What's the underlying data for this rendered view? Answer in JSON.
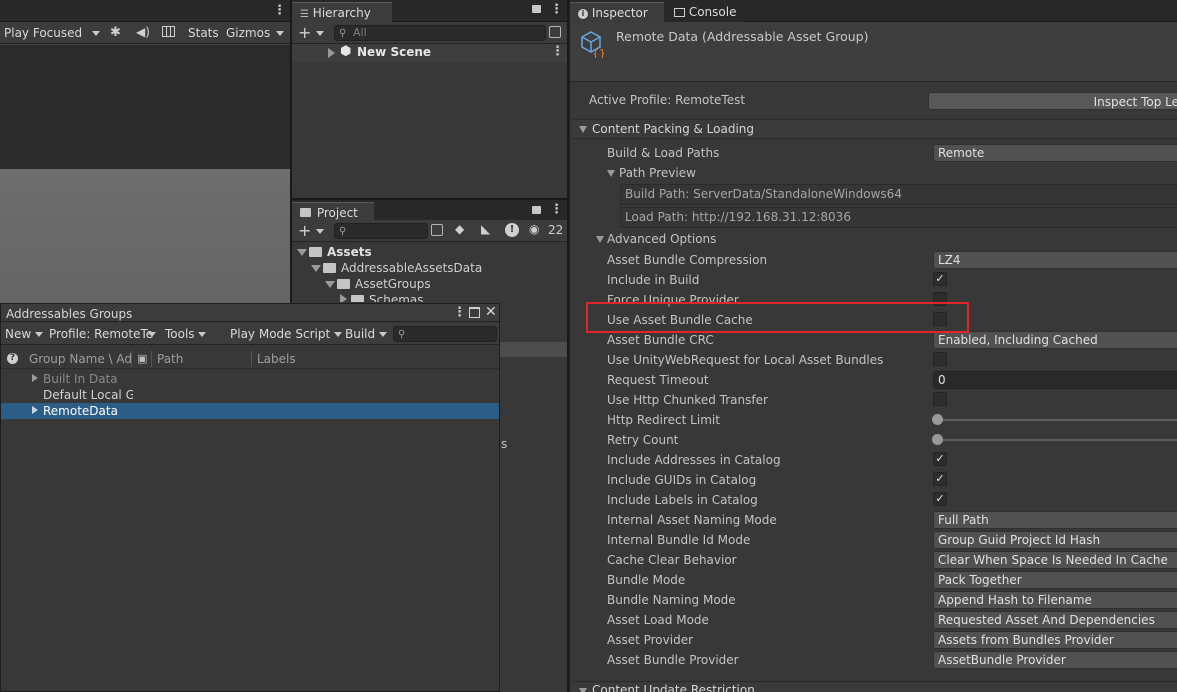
{
  "game_toolbar": {
    "play_focused": "Play Focused",
    "stats": "Stats",
    "gizmos": "Gizmos"
  },
  "hierarchy": {
    "tab": "Hierarchy",
    "search_placeholder": "All",
    "scene": "New Scene"
  },
  "project": {
    "tab": "Project",
    "hidden_count": "22",
    "tree": [
      "Assets",
      "AddressableAssetsData",
      "AssetGroups",
      "Schemas"
    ],
    "partial_text": "s"
  },
  "addressables": {
    "tab": "Addressables Groups",
    "toolbar": {
      "new": "New",
      "profile": "Profile: RemoteTe",
      "tools": "Tools",
      "play_mode": "Play Mode Script",
      "build": "Build"
    },
    "columns": {
      "group_name": "Group Name \\ Adc",
      "path": "Path",
      "labels": "Labels"
    },
    "rows": [
      {
        "name": "Built In Data"
      },
      {
        "name": "Default Local Gr"
      },
      {
        "name": "RemoteData"
      }
    ]
  },
  "inspector": {
    "tab": "Inspector",
    "console_tab": "Console",
    "title": "Remote Data (Addressable Asset Group)",
    "active_profile": "Active Profile: RemoteTest",
    "inspect_button": "Inspect Top Le",
    "section": "Content Packing & Loading",
    "build_load_label": "Build & Load Paths",
    "build_load_value": "Remote",
    "path_preview": "Path Preview",
    "build_path": "Build Path: ServerData/StandaloneWindows64",
    "load_path": "Load Path: http://192.168.31.12:8036",
    "advanced": "Advanced Options",
    "next_section": "Content Update Restriction",
    "props": [
      {
        "label": "Asset Bundle Compression",
        "kind": "dd",
        "value": "LZ4"
      },
      {
        "label": "Include in Build",
        "kind": "chk",
        "value": "✓"
      },
      {
        "label": "Force Unique Provider",
        "kind": "chk",
        "value": ""
      },
      {
        "label": "Use Asset Bundle Cache",
        "kind": "chk",
        "value": ""
      },
      {
        "label": "Asset Bundle CRC",
        "kind": "dd",
        "value": "Enabled, Including Cached"
      },
      {
        "label": "Use UnityWebRequest for Local Asset Bundles",
        "kind": "chk",
        "value": ""
      },
      {
        "label": "Request Timeout",
        "kind": "txt",
        "value": "0"
      },
      {
        "label": "Use Http Chunked Transfer",
        "kind": "chk",
        "value": ""
      },
      {
        "label": "Http Redirect Limit",
        "kind": "slider",
        "value": ""
      },
      {
        "label": "Retry Count",
        "kind": "slider",
        "value": ""
      },
      {
        "label": "Include Addresses in Catalog",
        "kind": "chk",
        "value": "✓"
      },
      {
        "label": "Include GUIDs in Catalog",
        "kind": "chk",
        "value": "✓"
      },
      {
        "label": "Include Labels in Catalog",
        "kind": "chk",
        "value": "✓"
      },
      {
        "label": "Internal Asset Naming Mode",
        "kind": "dd",
        "value": "Full Path"
      },
      {
        "label": "Internal Bundle Id Mode",
        "kind": "dd",
        "value": "Group Guid Project Id Hash"
      },
      {
        "label": "Cache Clear Behavior",
        "kind": "dd",
        "value": "Clear When Space Is Needed In Cache"
      },
      {
        "label": "Bundle Mode",
        "kind": "dd",
        "value": "Pack Together"
      },
      {
        "label": "Bundle Naming Mode",
        "kind": "dd",
        "value": "Append Hash to Filename"
      },
      {
        "label": "Asset Load Mode",
        "kind": "dd",
        "value": "Requested Asset And Dependencies"
      },
      {
        "label": "Asset Provider",
        "kind": "dd",
        "value": "Assets from Bundles Provider"
      },
      {
        "label": "Asset Bundle Provider",
        "kind": "dd",
        "value": "AssetBundle Provider"
      }
    ],
    "highlight_color": "#e0262a"
  }
}
